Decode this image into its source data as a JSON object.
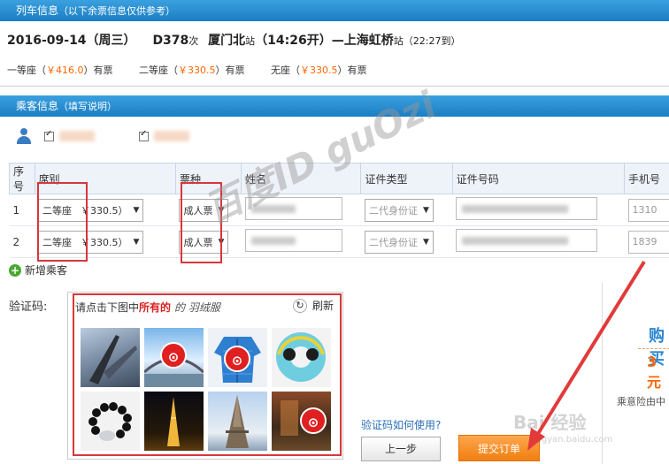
{
  "train_info": {
    "header": "列车信息",
    "header_note": "（以下余票信息仅供参考）",
    "date": "2016-09-14（周三）",
    "train_no": "D378",
    "train_suffix": "次",
    "from_station": "厦门北",
    "station_suffix": "站",
    "depart": "（14:26开）—",
    "to_station": "上海虹桥",
    "arrive": "（22:27到）",
    "seats": [
      {
        "name": "一等座（",
        "price": "￥416.0",
        "status": "）有票"
      },
      {
        "name": "二等座（",
        "price": "￥330.5",
        "status": "）有票"
      },
      {
        "name": "无座（",
        "price": "￥330.5",
        "status": "）有票"
      }
    ]
  },
  "passenger_info": {
    "header": "乘客信息",
    "header_note": "（填写说明）",
    "columns": [
      "序号",
      "席别",
      "票种",
      "姓名",
      "证件类型",
      "证件号码",
      "手机号"
    ],
    "rows": [
      {
        "index": "1",
        "seat": "二等座",
        "seat_price": "￥330.5）",
        "ticket": "成人票",
        "id_type": "二代身份证",
        "phone": "1310"
      },
      {
        "index": "2",
        "seat": "二等座",
        "seat_price": "￥330.5）",
        "ticket": "成人票",
        "id_type": "二代身份证",
        "phone": "1839"
      }
    ],
    "add_label": "新增乘客"
  },
  "captcha": {
    "label": "验证码:",
    "prompt": "请点击下图中",
    "prompt_emph": "所有的",
    "prompt_obj": "的   羽绒服",
    "refresh": "刷新",
    "help": "验证码如何使用?"
  },
  "side": {
    "buy": "购买",
    "price": "3元",
    "insurance": "乘意险由中"
  },
  "actions": {
    "prev": "上一步",
    "submit": "提交订单"
  },
  "watermark": "百度ID guOzi",
  "baidu_text": "Bai 经验",
  "baidu_url": "jingyan.baidu.com",
  "colors": {
    "accent": "#1c7ec4",
    "price": "#ff6600",
    "highlight": "#d9363a",
    "submit": "#f07f10"
  }
}
